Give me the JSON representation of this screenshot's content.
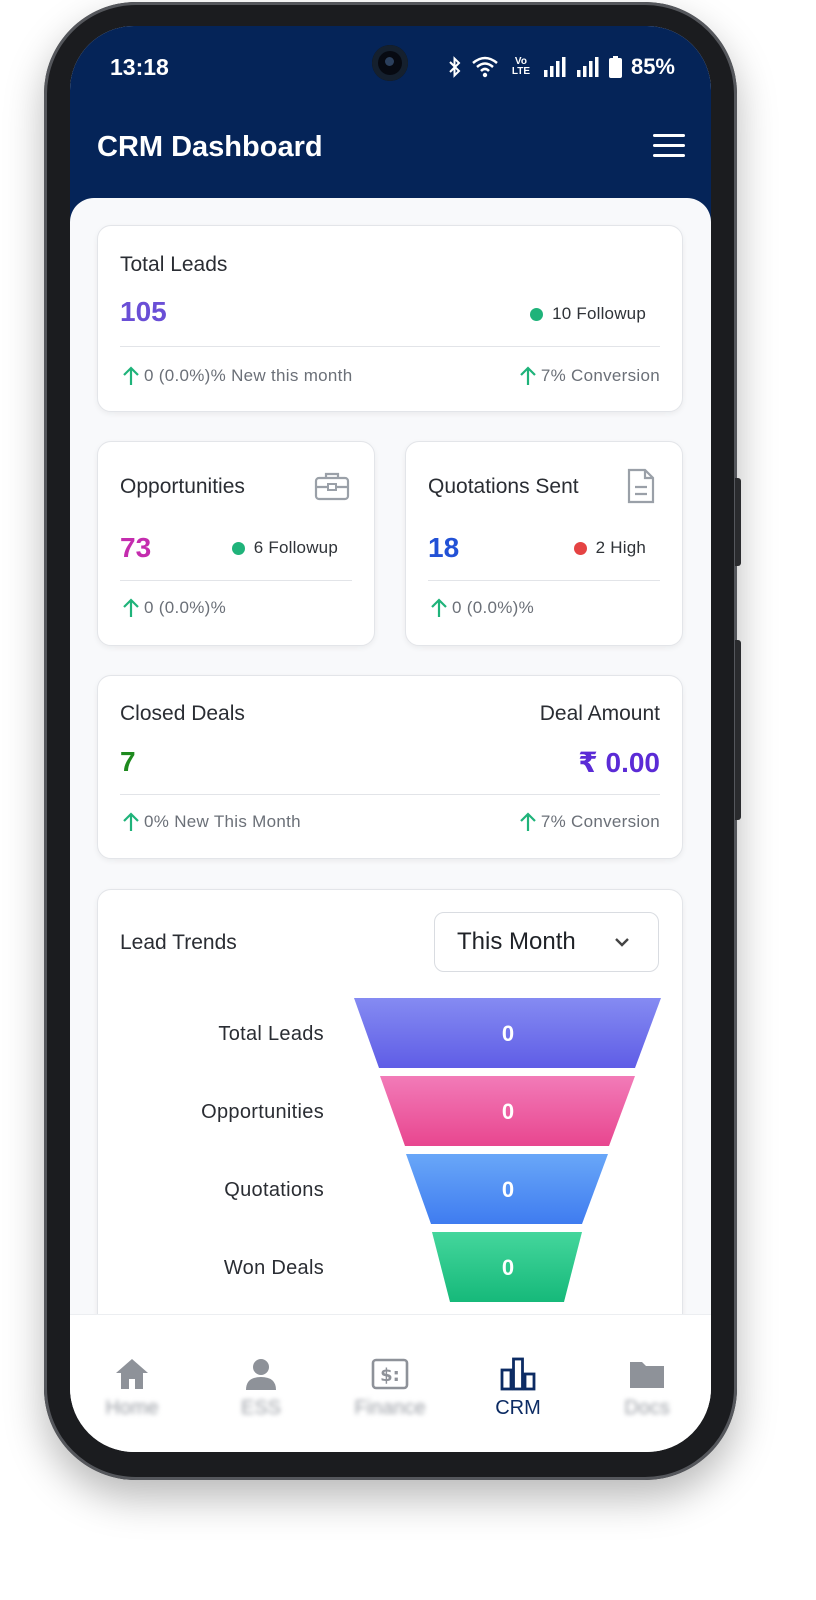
{
  "status_bar": {
    "time": "13:18",
    "volte": "Vo LTE",
    "battery": "85%"
  },
  "header": {
    "title": "CRM Dashboard"
  },
  "colors": {
    "header": "#052458",
    "purple": "#6a4fd6",
    "magenta": "#c42cae",
    "blue": "#2251d6",
    "green": "#1e8a1e",
    "teal": "#1fb37a",
    "red": "#e54343"
  },
  "total_leads": {
    "title": "Total Leads",
    "value": "105",
    "followup": "10 Followup",
    "new_this_month": "0 (0.0%)% New this month",
    "conversion": "7% Conversion"
  },
  "opportunities": {
    "title": "Opportunities",
    "value": "73",
    "followup": "6 Followup",
    "change": "0 (0.0%)%",
    "icon": "briefcase-icon"
  },
  "quotations": {
    "title": "Quotations Sent",
    "value": "18",
    "priority": "2 High",
    "change": "0 (0.0%)%",
    "icon": "document-icon"
  },
  "closed_deals": {
    "title": "Closed Deals",
    "value": "7",
    "deal_amount_label": "Deal Amount",
    "deal_amount": "₹ 0.00",
    "new_this_month": "0% New This Month",
    "conversion": "7% Conversion"
  },
  "lead_trends": {
    "title": "Lead Trends",
    "period": "This Month",
    "stages": [
      {
        "label": "Total Leads",
        "value": "0"
      },
      {
        "label": "Opportunities",
        "value": "0"
      },
      {
        "label": "Quotations",
        "value": "0"
      },
      {
        "label": "Won Deals",
        "value": "0"
      }
    ]
  },
  "bottom_nav": [
    {
      "label": "Home",
      "icon": "home-icon"
    },
    {
      "label": "ESS",
      "icon": "person-icon"
    },
    {
      "label": "Finance",
      "icon": "finance-icon"
    },
    {
      "label": "CRM",
      "icon": "bar-chart-icon",
      "active": true
    },
    {
      "label": "Docs",
      "icon": "folder-icon"
    }
  ]
}
